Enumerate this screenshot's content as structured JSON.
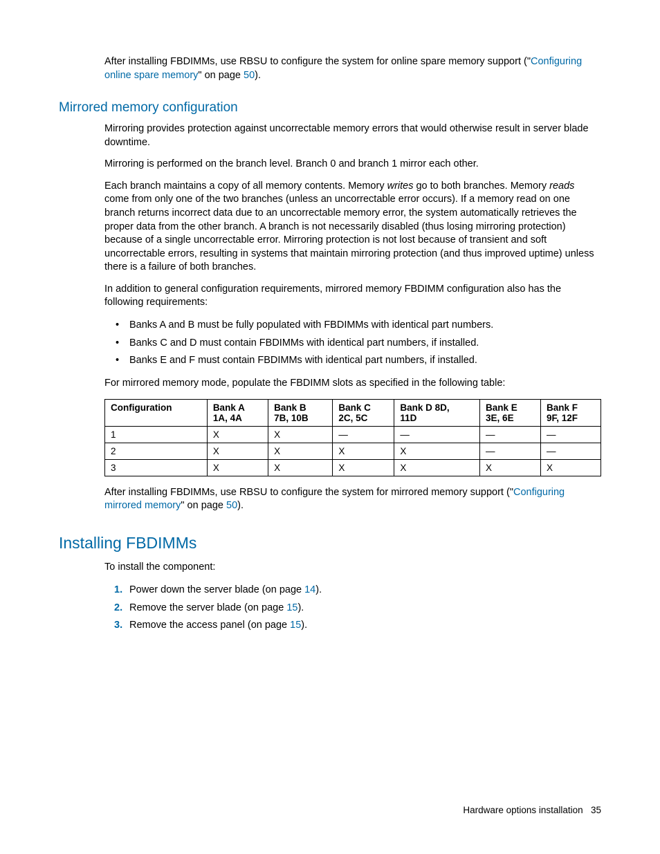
{
  "intro": {
    "pre": "After installing FBDIMMs, use RBSU to configure the system for online spare memory support (\"",
    "link": "Configuring online spare memory",
    "mid": "\" on page ",
    "page": "50",
    "post": ")."
  },
  "section1": {
    "heading": "Mirrored memory configuration",
    "p1": "Mirroring provides protection against uncorrectable memory errors that would otherwise result in server blade downtime.",
    "p2": "Mirroring is performed on the branch level. Branch 0 and branch 1 mirror each other.",
    "p3_a": "Each branch maintains a copy of all memory contents. Memory ",
    "p3_writes": "writes",
    "p3_b": " go to both branches. Memory ",
    "p3_reads": "reads",
    "p3_c": " come from only one of the two branches (unless an uncorrectable error occurs). If a memory read on one branch returns incorrect data due to an uncorrectable memory error, the system automatically retrieves the proper data from the other branch. A branch is not necessarily disabled (thus losing mirroring protection) because of a single uncorrectable error. Mirroring protection is not lost because of transient and soft uncorrectable errors, resulting in systems that maintain mirroring protection (and thus improved uptime) unless there is a failure of both branches.",
    "p4": "In addition to general configuration requirements, mirrored memory FBDIMM configuration also has the following requirements:",
    "bullets": [
      "Banks A and B must be fully populated with FBDIMMs with identical part numbers.",
      "Banks C and D must contain FBDIMMs with identical part numbers, if installed.",
      "Banks E and F must contain FBDIMMs with identical part numbers, if installed."
    ],
    "p5": "For mirrored memory mode, populate the FBDIMM slots as specified in the following table:",
    "after_pre": "After installing FBDIMMs, use RBSU to configure the system for mirrored memory support (\"",
    "after_link": "Configuring mirrored memory",
    "after_mid": "\" on page ",
    "after_page": "50",
    "after_post": ")."
  },
  "table": {
    "headers": [
      "Configuration",
      "Bank A 1A, 4A",
      "Bank B 7B, 10B",
      "Bank C 2C, 5C",
      "Bank D 8D, 11D",
      "Bank E 3E, 6E",
      "Bank F 9F, 12F"
    ],
    "header_lines": [
      [
        "Configuration"
      ],
      [
        "Bank A",
        "1A, 4A"
      ],
      [
        "Bank B",
        "7B, 10B"
      ],
      [
        "Bank C",
        "2C, 5C"
      ],
      [
        "Bank D 8D,",
        "11D"
      ],
      [
        "Bank E",
        "3E, 6E"
      ],
      [
        "Bank F",
        "9F, 12F"
      ]
    ],
    "rows": [
      [
        "1",
        "X",
        "X",
        "—",
        "—",
        "—",
        "—"
      ],
      [
        "2",
        "X",
        "X",
        "X",
        "X",
        "—",
        "—"
      ],
      [
        "3",
        "X",
        "X",
        "X",
        "X",
        "X",
        "X"
      ]
    ]
  },
  "section2": {
    "heading": "Installing FBDIMMs",
    "p1": "To install the component:",
    "steps": [
      {
        "pre": "Power down the server blade (on page ",
        "page": "14",
        "post": ")."
      },
      {
        "pre": "Remove the server blade (on page ",
        "page": "15",
        "post": ")."
      },
      {
        "pre": "Remove the access panel (on page ",
        "page": "15",
        "post": ")."
      }
    ]
  },
  "footer": {
    "label": "Hardware options installation",
    "page": "35"
  }
}
